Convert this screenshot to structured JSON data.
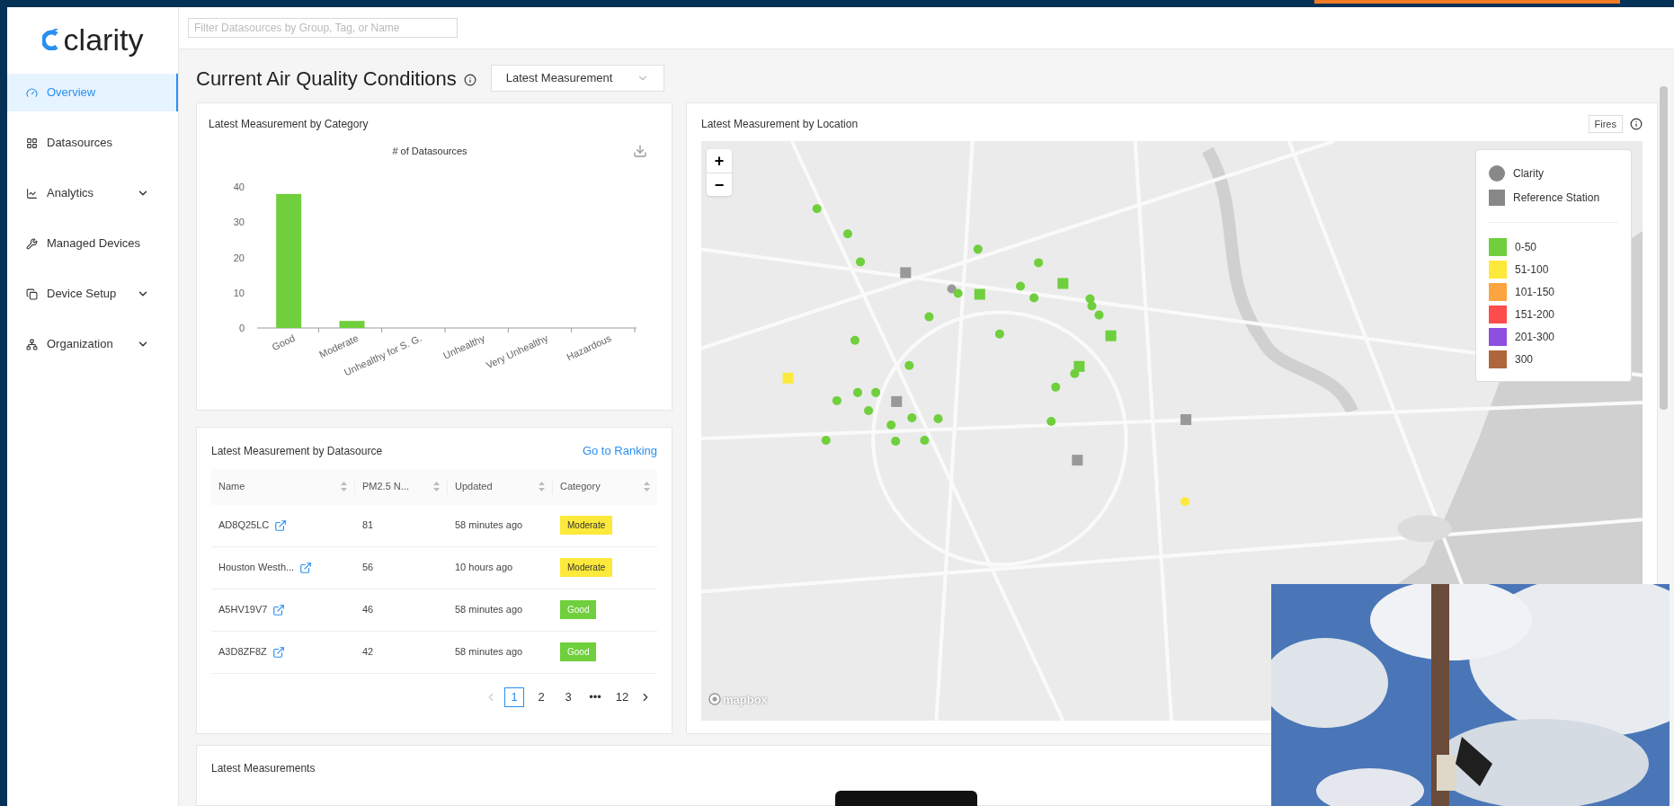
{
  "brand": {
    "name": "clarity"
  },
  "search": {
    "placeholder": "Filter Datasources by Group, Tag, or Name"
  },
  "sidebar": {
    "items": [
      {
        "label": "Overview",
        "selected": true,
        "kind": "link"
      },
      {
        "label": "Datasources",
        "selected": false,
        "kind": "link"
      },
      {
        "label": "Analytics",
        "selected": false,
        "kind": "group"
      },
      {
        "label": "Managed Devices",
        "selected": false,
        "kind": "link"
      },
      {
        "label": "Device Setup",
        "selected": false,
        "kind": "group"
      },
      {
        "label": "Organization",
        "selected": false,
        "kind": "group"
      }
    ]
  },
  "page": {
    "title": "Current Air Quality Conditions",
    "period_select": {
      "value": "Latest Measurement"
    }
  },
  "category_card": {
    "title": "Latest Measurement by Category",
    "chart_data": {
      "type": "bar",
      "title": "# of Datasources",
      "categories": [
        "Good",
        "Moderate",
        "Unhealthy for S. G.",
        "Unhealthy",
        "Very Unhealthy",
        "Hazardous"
      ],
      "series": [
        {
          "color": "#6fcf3c",
          "values": [
            38,
            2,
            0,
            0,
            0,
            0
          ]
        }
      ],
      "ylim": [
        0,
        40
      ],
      "yticks": [
        0,
        10,
        20,
        30,
        40
      ]
    }
  },
  "datasource_card": {
    "title": "Latest Measurement by Datasource",
    "link": "Go to Ranking",
    "columns": [
      "Name",
      "PM2.5 N...",
      "Updated",
      "Category"
    ],
    "rows": [
      {
        "name": "AD8Q25LC",
        "value": "81",
        "updated": "58 minutes ago",
        "category": {
          "label": "Moderate",
          "color": "#fde93b"
        }
      },
      {
        "name": "Houston Westh...",
        "value": "56",
        "updated": "10 hours ago",
        "category": {
          "label": "Moderate",
          "color": "#fde93b"
        }
      },
      {
        "name": "A5HV19V7",
        "value": "46",
        "updated": "58 minutes ago",
        "category": {
          "label": "Good",
          "color": "#6fcf3c"
        }
      },
      {
        "name": "A3D8ZF8Z",
        "value": "42",
        "updated": "58 minutes ago",
        "category": {
          "label": "Good",
          "color": "#6fcf3c"
        }
      }
    ],
    "pagination": {
      "pages": [
        {
          "label": "1",
          "selected": true
        },
        {
          "label": "2",
          "selected": false
        },
        {
          "label": "3",
          "selected": false
        },
        {
          "label": "•••",
          "selected": false
        },
        {
          "label": "12",
          "selected": false
        }
      ]
    }
  },
  "location_card": {
    "title": "Latest Measurement by Location",
    "fires_button": "Fires",
    "zoom_in": "+",
    "zoom_out": "−",
    "attribution": "mapbox",
    "legend": {
      "types": [
        {
          "label": "Clarity",
          "kind": "circle"
        },
        {
          "label": "Reference Station",
          "kind": "square"
        }
      ],
      "ranges": [
        {
          "label": "0-50",
          "color": "#6fcf3c"
        },
        {
          "label": "51-100",
          "color": "#fde93b"
        },
        {
          "label": "101-150",
          "color": "#fca440"
        },
        {
          "label": "151-200",
          "color": "#fc4c4c"
        },
        {
          "label": "201-300",
          "color": "#8e4fe0"
        },
        {
          "label": "300",
          "color": "#b0663b"
        }
      ]
    }
  },
  "measurements_card": {
    "title": "Latest Measurements"
  }
}
